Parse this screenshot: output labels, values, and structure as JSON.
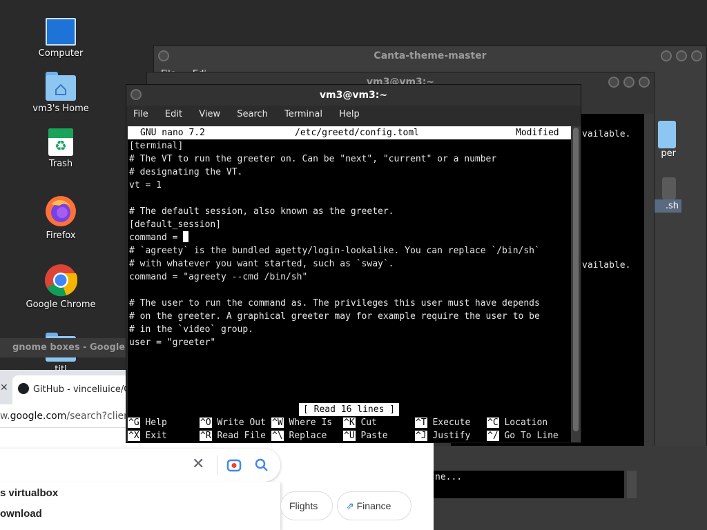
{
  "desktop": {
    "icons": [
      {
        "label": "Computer",
        "icon": "monitor-icon"
      },
      {
        "label": "vm3's Home",
        "icon": "home-folder-icon"
      },
      {
        "label": "Trash",
        "icon": "trash-icon"
      },
      {
        "label": "Firefox",
        "icon": "firefox-icon"
      },
      {
        "label": "Google Chrome",
        "icon": "chrome-icon"
      },
      {
        "label": "",
        "icon": "folder-icon"
      }
    ],
    "partial_labels": {
      "folder_below": "titl",
      "right_icon_1": "per",
      "right_icon_2": ".sh"
    }
  },
  "file_manager": {
    "title": "Canta-theme-master",
    "menu": [
      "File",
      "Edi"
    ]
  },
  "bg_terminal": {
    "title": "vm3@vm3:~",
    "lines": [
      "vailable.",
      "vailable.",
      "ne..."
    ]
  },
  "terminal": {
    "title": "vm3@vm3:~",
    "menu": [
      "File",
      "Edit",
      "View",
      "Search",
      "Terminal",
      "Help"
    ],
    "nano": {
      "version": "GNU nano 7.2",
      "file": "/etc/greetd/config.toml",
      "state": "Modified",
      "lines": [
        "[terminal]",
        "# The VT to run the greeter on. Can be \"next\", \"current\" or a number",
        "# designating the VT.",
        "vt = 1",
        "",
        "# The default session, also known as the greeter.",
        "[default_session]",
        "command = ",
        "# `agreety` is the bundled agetty/login-lookalike. You can replace `/bin/sh`",
        "# with whatever you want started, such as `sway`.",
        "command = \"agreety --cmd /bin/sh\"",
        "",
        "# The user to run the command as. The privileges this user must have depends",
        "# on the greeter. A graphical greeter may for example require the user to be",
        "# in the `video` group.",
        "user = \"greeter\""
      ],
      "status": "[ Read 16 lines ]",
      "shortcuts_row1": [
        {
          "key": "^G",
          "label": "Help"
        },
        {
          "key": "^O",
          "label": "Write Out"
        },
        {
          "key": "^W",
          "label": "Where Is"
        },
        {
          "key": "^K",
          "label": "Cut"
        },
        {
          "key": "^T",
          "label": "Execute"
        },
        {
          "key": "^C",
          "label": "Location"
        }
      ],
      "shortcuts_row2": [
        {
          "key": "^X",
          "label": "Exit"
        },
        {
          "key": "^R",
          "label": "Read File"
        },
        {
          "key": "^\\",
          "label": "Replace"
        },
        {
          "key": "^U",
          "label": "Paste"
        },
        {
          "key": "^J",
          "label": "Justify"
        },
        {
          "key": "^/",
          "label": "Go To Line"
        }
      ]
    }
  },
  "chrome": {
    "window_title": "gnome boxes - Google Sea",
    "tab_title": "GitHub - vinceliuice/C",
    "url_prefix": "w.",
    "url_domain": "google.com",
    "url_path": "/search?client",
    "suggestions": [
      "s virtualbox",
      "ownload"
    ],
    "chips": [
      "Flights",
      "Finance"
    ]
  }
}
